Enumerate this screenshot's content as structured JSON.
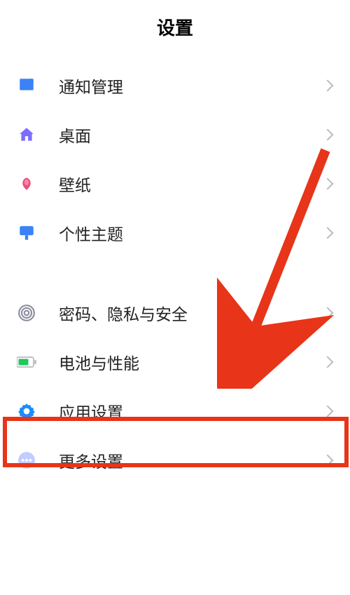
{
  "header": {
    "title": "设置"
  },
  "items": [
    {
      "id": "notifications",
      "label": "通知管理",
      "icon": "notification-icon"
    },
    {
      "id": "desktop",
      "label": "桌面",
      "icon": "home-icon"
    },
    {
      "id": "wallpaper",
      "label": "壁纸",
      "icon": "wallpaper-icon"
    },
    {
      "id": "theme",
      "label": "个性主题",
      "icon": "theme-icon"
    },
    {
      "id": "privacy",
      "label": "密码、隐私与安全",
      "icon": "fingerprint-icon"
    },
    {
      "id": "battery",
      "label": "电池与性能",
      "icon": "battery-icon"
    },
    {
      "id": "apps",
      "label": "应用设置",
      "icon": "apps-gear-icon"
    },
    {
      "id": "more",
      "label": "更多设置",
      "icon": "more-icon"
    }
  ],
  "annotation": {
    "highlight_target": "apps",
    "highlight_color": "#e83418"
  }
}
